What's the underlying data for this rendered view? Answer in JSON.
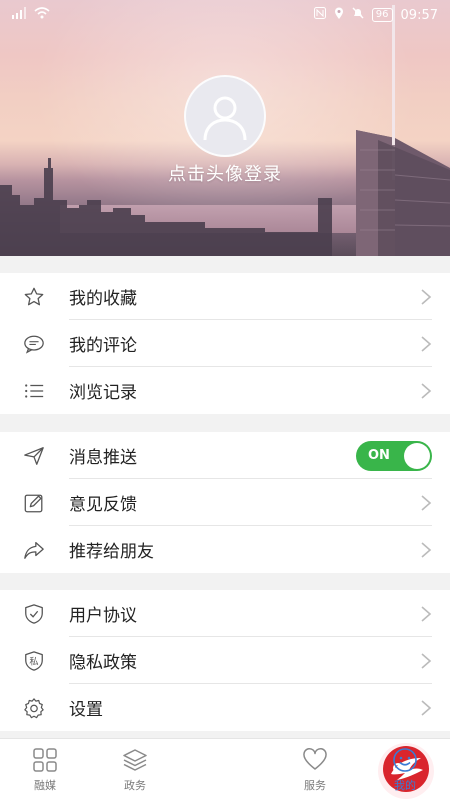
{
  "status_bar": {
    "battery": "96",
    "time": "09:57"
  },
  "profile": {
    "login_text": "点击头像登录"
  },
  "groups": [
    {
      "items": [
        {
          "label": "我的收藏",
          "icon": "star-icon"
        },
        {
          "label": "我的评论",
          "icon": "comment-icon"
        },
        {
          "label": "浏览记录",
          "icon": "list-icon"
        }
      ]
    },
    {
      "items": [
        {
          "label": "消息推送",
          "icon": "send-icon",
          "toggle": "ON"
        },
        {
          "label": "意见反馈",
          "icon": "edit-icon"
        },
        {
          "label": "推荐给朋友",
          "icon": "share-icon"
        }
      ]
    },
    {
      "items": [
        {
          "label": "用户协议",
          "icon": "shield-check-icon"
        },
        {
          "label": "隐私政策",
          "icon": "privacy-shield-icon",
          "icon_text": "私"
        },
        {
          "label": "设置",
          "icon": "gear-icon"
        }
      ]
    }
  ],
  "tabs": [
    {
      "label": "融媒",
      "icon": "grid-icon"
    },
    {
      "label": "政务",
      "icon": "layers-icon"
    },
    {
      "label": "",
      "icon": "center-logo-icon"
    },
    {
      "label": "服务",
      "icon": "heart-icon"
    },
    {
      "label": "我的",
      "icon": "smile-icon",
      "active": true
    }
  ],
  "colors": {
    "toggle_on": "#39b54a",
    "tab_active": "#3a7bd5"
  }
}
